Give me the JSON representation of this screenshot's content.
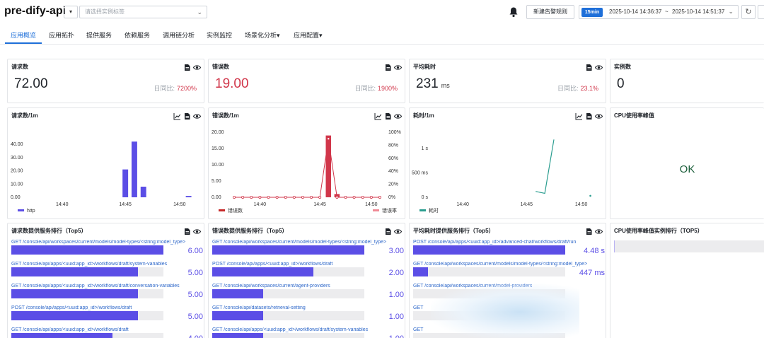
{
  "header": {
    "app_title": "pre-dify-api",
    "tag_placeholder": "请选择实例标签",
    "new_alert_label": "新建告警规则",
    "time_badge": "15min",
    "time_start": "2025-10-14 14:36:37",
    "time_sep": "~",
    "time_end": "2025-10-14 14:51:37"
  },
  "tabs": [
    "应用概览",
    "应用拓扑",
    "提供服务",
    "依赖服务",
    "调用链分析",
    "实例监控",
    "场景化分析▾",
    "应用配置▾"
  ],
  "colors": {
    "accent": "#1e6fd9",
    "bar_purple": "#5b4ee6",
    "error_red": "#d1364a",
    "line_teal": "#2a9d8f"
  },
  "stats": {
    "requests": {
      "title": "请求数",
      "value": "72.00",
      "cmp_label": "日同比:",
      "cmp_value": "7200%"
    },
    "errors": {
      "title": "错误数",
      "value": "19.00",
      "cmp_label": "日同比:",
      "cmp_value": "1900%"
    },
    "latency": {
      "title": "平均耗时",
      "value": "231",
      "unit": "ms",
      "cmp_label": "日同比:",
      "cmp_value": "23.1%"
    },
    "instances": {
      "title": "实例数",
      "value": "0"
    }
  },
  "cpu_peak": {
    "title": "CPU使用率峰值",
    "status": "OK"
  },
  "chart_data": [
    {
      "type": "bar",
      "title": "请求数/1m",
      "x_ticks": [
        "14:40",
        "14:45",
        "14:50"
      ],
      "y_ticks": [
        "40.00",
        "30.00",
        "20.00",
        "10.00",
        "0.00"
      ],
      "ylim": [
        0,
        48
      ],
      "legend": [
        "http"
      ],
      "series": [
        {
          "name": "http",
          "values": [
            0,
            0,
            0,
            0,
            0,
            0,
            0,
            0,
            0,
            0,
            21,
            42,
            8,
            0,
            0,
            0,
            0,
            1
          ]
        }
      ]
    },
    {
      "type": "bar",
      "title": "错误数/1m",
      "x_ticks": [
        "14:40",
        "14:45",
        "14:50"
      ],
      "y_ticks": [
        "20.00",
        "15.00",
        "10.00",
        "5.00",
        "0.00"
      ],
      "y2_ticks": [
        "100%",
        "80%",
        "60%",
        "40%",
        "20%",
        "0%"
      ],
      "ylim": [
        0,
        20
      ],
      "legend": [
        "错误数",
        "错误率"
      ],
      "series": [
        {
          "name": "错误数",
          "values": [
            0,
            0,
            0,
            0,
            0,
            0,
            0,
            0,
            0,
            0,
            0,
            19,
            1,
            0,
            0,
            0,
            0,
            0
          ]
        },
        {
          "name": "错误率",
          "values": [
            0,
            0,
            0,
            0,
            0,
            0,
            0,
            0,
            0,
            0,
            0,
            90,
            0,
            0,
            0,
            0,
            0,
            0
          ]
        }
      ]
    },
    {
      "type": "line",
      "title": "耗时/1m",
      "x_ticks": [
        "14:40",
        "14:45",
        "14:50"
      ],
      "y_ticks": [
        "1 s",
        "500 ms",
        "0 s"
      ],
      "ylim": [
        0,
        1300
      ],
      "legend": [
        "耗时"
      ],
      "series": [
        {
          "name": "耗时",
          "values": [
            null,
            null,
            null,
            null,
            null,
            null,
            null,
            null,
            null,
            null,
            null,
            120,
            80,
            1180,
            null,
            null,
            null,
            30
          ]
        }
      ]
    }
  ],
  "rank_panels": [
    {
      "title": "请求数提供服务排行（Top5）",
      "max": 6,
      "items": [
        {
          "label": "GET /console/api/workspaces/current/models/model-types/<string:model_type>",
          "value": 6,
          "display": "6.00"
        },
        {
          "label": "GET /console/api/apps/<uuid:app_id>/workflows/draft/system-variables",
          "value": 5,
          "display": "5.00"
        },
        {
          "label": "GET /console/api/apps/<uuid:app_id>/workflows/draft/conversation-variables",
          "value": 5,
          "display": "5.00"
        },
        {
          "label": "POST /console/api/apps/<uuid:app_id>/workflows/draft",
          "value": 5,
          "display": "5.00"
        },
        {
          "label": "GET /console/api/apps/<uuid:app_id>/workflows/draft",
          "value": 4,
          "display": "4.00"
        }
      ]
    },
    {
      "title": "错误数提供服务排行（Top5）",
      "max": 3,
      "items": [
        {
          "label": "GET /console/api/workspaces/current/models/model-types/<string:model_type>",
          "value": 3,
          "display": "3.00"
        },
        {
          "label": "POST /console/api/apps/<uuid:app_id>/workflows/draft",
          "value": 2,
          "display": "2.00"
        },
        {
          "label": "GET /console/api/workspaces/current/agent-providers",
          "value": 1,
          "display": "1.00"
        },
        {
          "label": "GET /console/api/datasets/retrieval-setting",
          "value": 1,
          "display": "1.00"
        },
        {
          "label": "GET /console/api/apps/<uuid:app_id>/workflows/draft/system-variables",
          "value": 1,
          "display": "1.00"
        }
      ]
    },
    {
      "title": "平均耗时提供服务排行（Top5）",
      "max": 4.48,
      "items": [
        {
          "label": "POST /console/api/apps/<uuid:app_id>/advanced-chat/workflows/draft/run",
          "value": 4.48,
          "display": "4.48 s"
        },
        {
          "label": "GET /console/api/workspaces/current/models/model-types/<string:model_type>",
          "value": 0.447,
          "display": "447 ms"
        },
        {
          "label": "GET /console/api/workspaces/current/model-providers",
          "value": 0,
          "display": ""
        },
        {
          "label": "GET",
          "value": 0,
          "display": ""
        },
        {
          "label": "GET",
          "value": 0,
          "display": ""
        }
      ]
    }
  ],
  "cpu_rank": {
    "title": "CPU使用率峰值实例排行（TOP5）"
  }
}
